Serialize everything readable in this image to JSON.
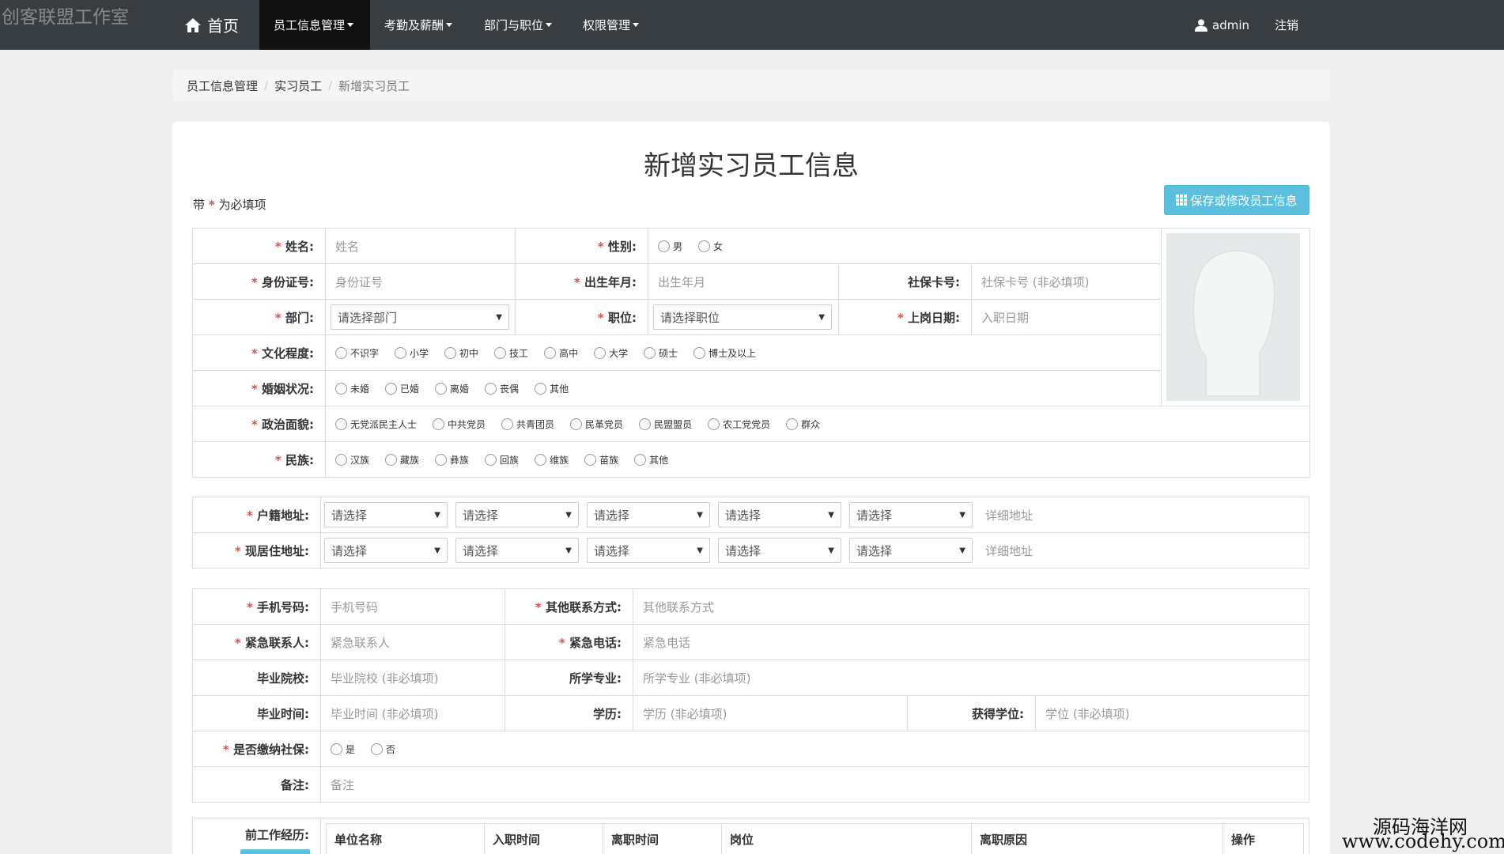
{
  "watermark": {
    "top_left": "创客联盟工作室",
    "site_name": "源码海洋网",
    "site_url": "www.codehy.com"
  },
  "nav": {
    "home": "首页",
    "items": [
      "员工信息管理",
      "考勤及薪酬",
      "部门与职位",
      "权限管理"
    ],
    "user": "admin",
    "logout": "注销"
  },
  "breadcrumb": [
    "员工信息管理",
    "实习员工",
    "新增实习员工"
  ],
  "page": {
    "title": "新增实习员工信息",
    "required_prefix": "带",
    "required_suffix": "为必填项",
    "save_button": "保存或修改员工信息"
  },
  "basic": {
    "name_label": "姓名:",
    "name_placeholder": "姓名",
    "gender_label": "性别:",
    "gender_options": [
      "男",
      "女"
    ],
    "id_label": "身份证号:",
    "id_placeholder": "身份证号",
    "birth_label": "出生年月:",
    "birth_placeholder": "出生年月",
    "social_label": "社保卡号:",
    "social_placeholder": "社保卡号 (非必填项)",
    "dept_label": "部门:",
    "dept_select": "请选择部门",
    "post_label": "职位:",
    "post_select": "请选择职位",
    "entry_label": "上岗日期:",
    "entry_placeholder": "入职日期",
    "edu_label": "文化程度:",
    "edu_options": [
      "不识字",
      "小学",
      "初中",
      "技工",
      "高中",
      "大学",
      "硕士",
      "博士及以上"
    ],
    "marital_label": "婚姻状况:",
    "marital_options": [
      "未婚",
      "已婚",
      "离婚",
      "丧偶",
      "其他"
    ],
    "political_label": "政治面貌:",
    "political_options": [
      "无党派民主人士",
      "中共党员",
      "共青团员",
      "民革党员",
      "民盟盟员",
      "农工党党员",
      "群众"
    ],
    "ethnic_label": "民族:",
    "ethnic_options": [
      "汉族",
      "藏族",
      "彝族",
      "回族",
      "维族",
      "苗族",
      "其他"
    ]
  },
  "address": {
    "hukou_label": "户籍地址:",
    "current_label": "现居住地址:",
    "select_placeholder": "请选择",
    "detail_placeholder": "详细地址"
  },
  "contact": {
    "phone_label": "手机号码:",
    "phone_placeholder": "手机号码",
    "other_label": "其他联系方式:",
    "other_placeholder": "其他联系方式",
    "emerg_label": "紧急联系人:",
    "emerg_placeholder": "紧急联系人",
    "emerg_phone_label": "紧急电话:",
    "emerg_phone_placeholder": "紧急电话",
    "school_label": "毕业院校:",
    "school_placeholder": "毕业院校 (非必填项)",
    "major_label": "所学专业:",
    "major_placeholder": "所学专业 (非必填项)",
    "grad_label": "毕业时间:",
    "grad_placeholder": "毕业时间 (非必填项)",
    "degree_label": "学历:",
    "degree_placeholder": "学历 (非必填项)",
    "award_label": "获得学位:",
    "award_placeholder": "学位 (非必填项)",
    "insurance_label": "是否缴纳社保:",
    "insurance_options": [
      "是",
      "否"
    ],
    "remark_label": "备注:",
    "remark_placeholder": "备注"
  },
  "work": {
    "label": "前工作经历:",
    "headers": [
      "单位名称",
      "入职时间",
      "离职时间",
      "岗位",
      "离职原因",
      "操作"
    ]
  }
}
